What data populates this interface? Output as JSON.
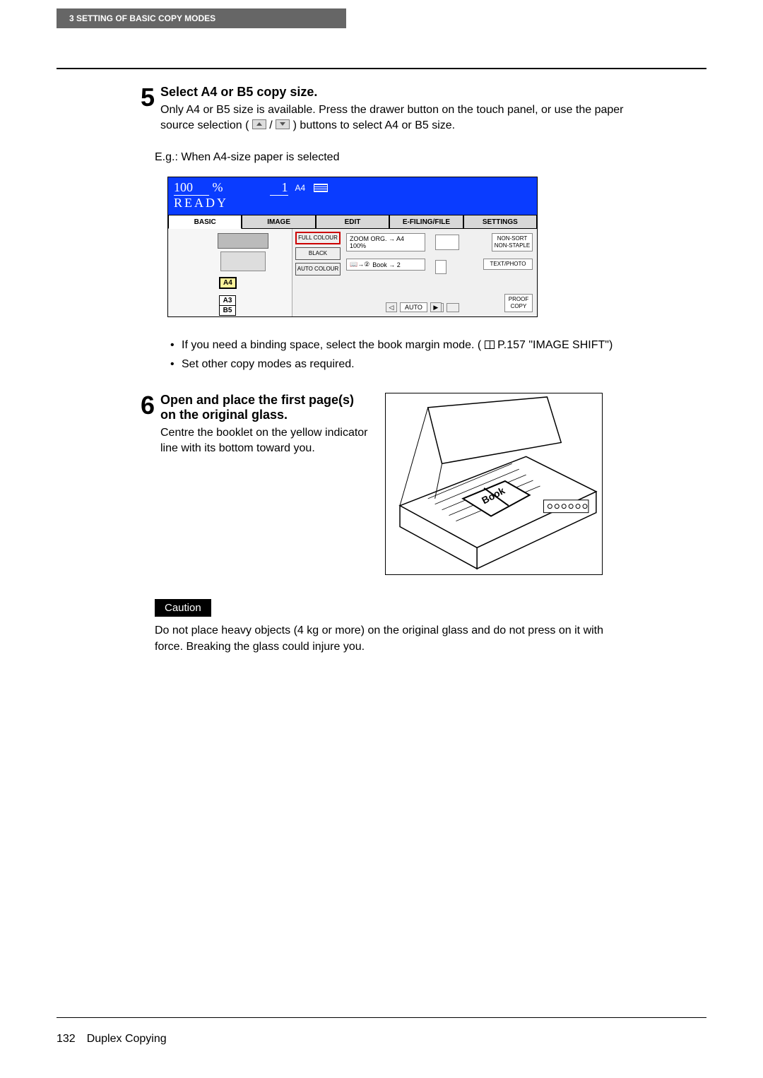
{
  "header": {
    "section_label": "3  SETTING OF BASIC COPY MODES"
  },
  "step5": {
    "num": "5",
    "title": "Select A4 or B5 copy size.",
    "body_pre": "Only A4 or B5 size is available. Press the drawer button on the touch panel, or use the paper source selection (",
    "body_sep": "/",
    "body_post": ") buttons to select A4 or B5 size.",
    "eg": "E.g.: When A4-size paper is selected"
  },
  "panel": {
    "percent": "100",
    "percent_sym": "%",
    "count": "1",
    "count_label": "A4",
    "ready": "READY",
    "tabs": [
      "BASIC",
      "IMAGE",
      "EDIT",
      "E-FILING/FILE",
      "SETTINGS"
    ],
    "labels": {
      "a4": "A4",
      "a3": "A3",
      "b5": "B5"
    },
    "mode_buttons": {
      "full_colour": "FULL COLOUR",
      "black": "BLACK",
      "auto_colour": "AUTO COLOUR"
    },
    "zoom_line1": "ZOOM   ORG. → A4",
    "zoom_line2": "100%",
    "book_line": "Book → 2",
    "non_sort": "NON-SORT\nNON-STAPLE",
    "text_photo": "TEXT/PHOTO",
    "auto": "AUTO",
    "proof": "PROOF\nCOPY"
  },
  "bullets": {
    "b1a": "If you need a binding space, select the book margin mode. (",
    "b1b": " P.157 \"IMAGE SHIFT\")",
    "b2": "Set other copy modes as required."
  },
  "step6": {
    "num": "6",
    "title": "Open and place the first page(s) on the original glass.",
    "body": "Centre the booklet on the yellow indicator line with its bottom toward you."
  },
  "caution": {
    "label": "Caution",
    "text": "Do not place heavy objects (4 kg or more) on the original glass and do not press on it with force. Breaking the glass could injure you."
  },
  "footer": {
    "page": "132",
    "title": "Duplex Copying"
  },
  "scanner_book_label": "Book"
}
